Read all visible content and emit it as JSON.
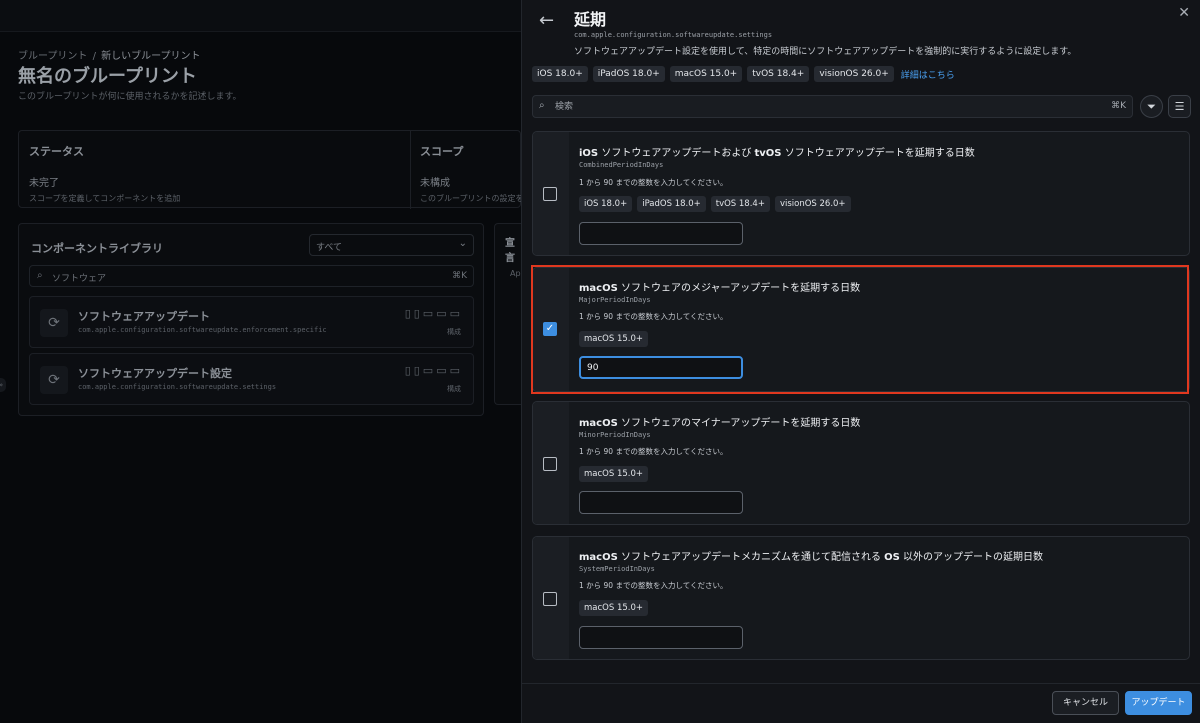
{
  "background": {
    "breadcrumb": {
      "root": "ブループリント",
      "separator": "/",
      "current": "新しいブループリント"
    },
    "title": "無名のブループリント",
    "description": "このブループリントが何に使用されるかを記述します。",
    "status": {
      "heading": "ステータス",
      "value": "未完了",
      "sub": "スコープを定義してコンポーネントを追加"
    },
    "scope": {
      "heading": "スコープ",
      "value": "未構成",
      "sub": "このブループリントの設定を"
    },
    "library": {
      "title": "コンポーネントライブラリ",
      "filter_value": "すべて",
      "search_value": "ソフトウェア",
      "search_shortcut": "⌘K",
      "items": [
        {
          "name": "ソフトウェアアップデート",
          "identifier": "com.apple.configuration.softwareupdate.enforcement.specific",
          "devices": "▯▯▭▭▭",
          "config_label": "構成"
        },
        {
          "name": "ソフトウェアアップデート設定",
          "identifier": "com.apple.configuration.softwareupdate.settings",
          "devices": "▯▯▭▭▭",
          "config_label": "構成"
        }
      ]
    },
    "declarations": {
      "heading": "宣言",
      "text": "Ap"
    }
  },
  "drawer": {
    "title": "延期",
    "identifier": "com.apple.configuration.softwareupdate.settings",
    "description": "ソフトウェアアップデート設定を使用して、特定の時間にソフトウェアアップデートを強制的に実行するように設定します。",
    "platforms": [
      "iOS 18.0+",
      "iPadOS 18.0+",
      "macOS 15.0+",
      "tvOS 18.4+",
      "visionOS 26.0+"
    ],
    "details_link": "詳細はこちら",
    "search": {
      "placeholder": "検索",
      "shortcut": "⌘K"
    },
    "sections": [
      {
        "title_bold_1": "iOS",
        "title_mid": " ソフトウェアアップデートおよび ",
        "title_bold_2": "tvOS",
        "title_rest": " ソフトウェアアップデートを延期する日数",
        "key": "CombinedPeriodInDays",
        "hint": "1 から 90 までの整数を入力してください。",
        "chips": [
          "iOS 18.0+",
          "iPadOS 18.0+",
          "tvOS 18.4+",
          "visionOS 26.0+"
        ],
        "value": "",
        "checked": false
      },
      {
        "title_bold_1": "macOS",
        "title_rest": " ソフトウェアのメジャーアップデートを延期する日数",
        "key": "MajorPeriodInDays",
        "hint": "1 から 90 までの整数を入力してください。",
        "chips": [
          "macOS 15.0+"
        ],
        "value": "90",
        "checked": true
      },
      {
        "title_bold_1": "macOS",
        "title_rest": " ソフトウェアのマイナーアップデートを延期する日数",
        "key": "MinorPeriodInDays",
        "hint": "1 から 90 までの整数を入力してください。",
        "chips": [
          "macOS 15.0+"
        ],
        "value": "",
        "checked": false
      },
      {
        "title_bold_1": "macOS",
        "title_mid": " ソフトウェアアップデートメカニズムを通じて配信される ",
        "title_bold_2": "OS",
        "title_rest": " 以外のアップデートの延期日数",
        "key": "SystemPeriodInDays",
        "hint": "1 から 90 までの整数を入力してください。",
        "chips": [
          "macOS 15.0+"
        ],
        "value": "",
        "checked": false
      }
    ],
    "footer": {
      "cancel_label": "キャンセル",
      "update_label": "アップデート"
    }
  },
  "colors": {
    "accent": "#3d8ee0",
    "highlight": "#e0381f",
    "drawer_bg": "#121418"
  }
}
